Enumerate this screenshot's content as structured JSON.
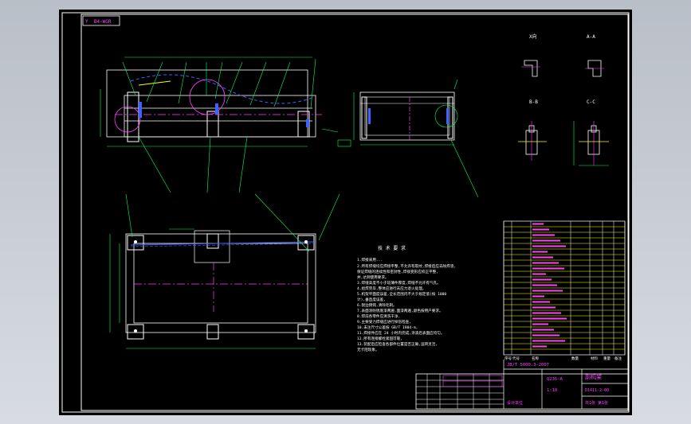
{
  "drawing": {
    "stamp": "Y  B4-WGR   ",
    "notes_title": "技 术 要 求",
    "notes": [
      "1.焊接采用...",
      "2.所有焊缝均应焊接平整,不允许有裂纹,焊接后应去除焊渣,",
      "   保证焊缝的连续性和密封性,焊接变形应校正平整,",
      "   并,达到使用要求。",
      "3.焊缝高度不小于较薄件厚度,焊缝不允许有气孔。",
      "4.组焊完毕,整体应进行去应力退火处理。",
      "5.机架平面度误差,全长范围内不大于规定值(按 1000",
      "   计),垂直度误差,",
      "6.锐边倒钝,清除毛刺。",
      "7.表面涂防锈底漆两遍,面漆两遍,颜色按用户要求。",
      "8.焊前各零件应清洗干净,",
      "9.主要受力焊缝应进行探伤检查,",
      "10.未注尺寸公差按 GB/T 1804-m,",
      "11.焊接件应在 24 小时内完成,涂漆后表面应均匀。",
      "12.所有连接螺栓紧固可靠,",
      "13.装配后应检查各部件位置是否正确,运转灵活,",
      "   无卡阻现象。"
    ],
    "section_views": [
      "X向",
      "A-A",
      "B-B",
      "C-C"
    ],
    "title_block": {
      "drawing_name": "副机架",
      "material": "Q235-A",
      "scale": "1:10",
      "sheet": "共1张 第1张",
      "drawing_no": "D1411-2-00",
      "standard": "JB/T 5000.3-2007",
      "company": "设计单位"
    },
    "bom_header": [
      "序号",
      "代号",
      "名称",
      "数量",
      "材料",
      "重量",
      "备注"
    ]
  }
}
